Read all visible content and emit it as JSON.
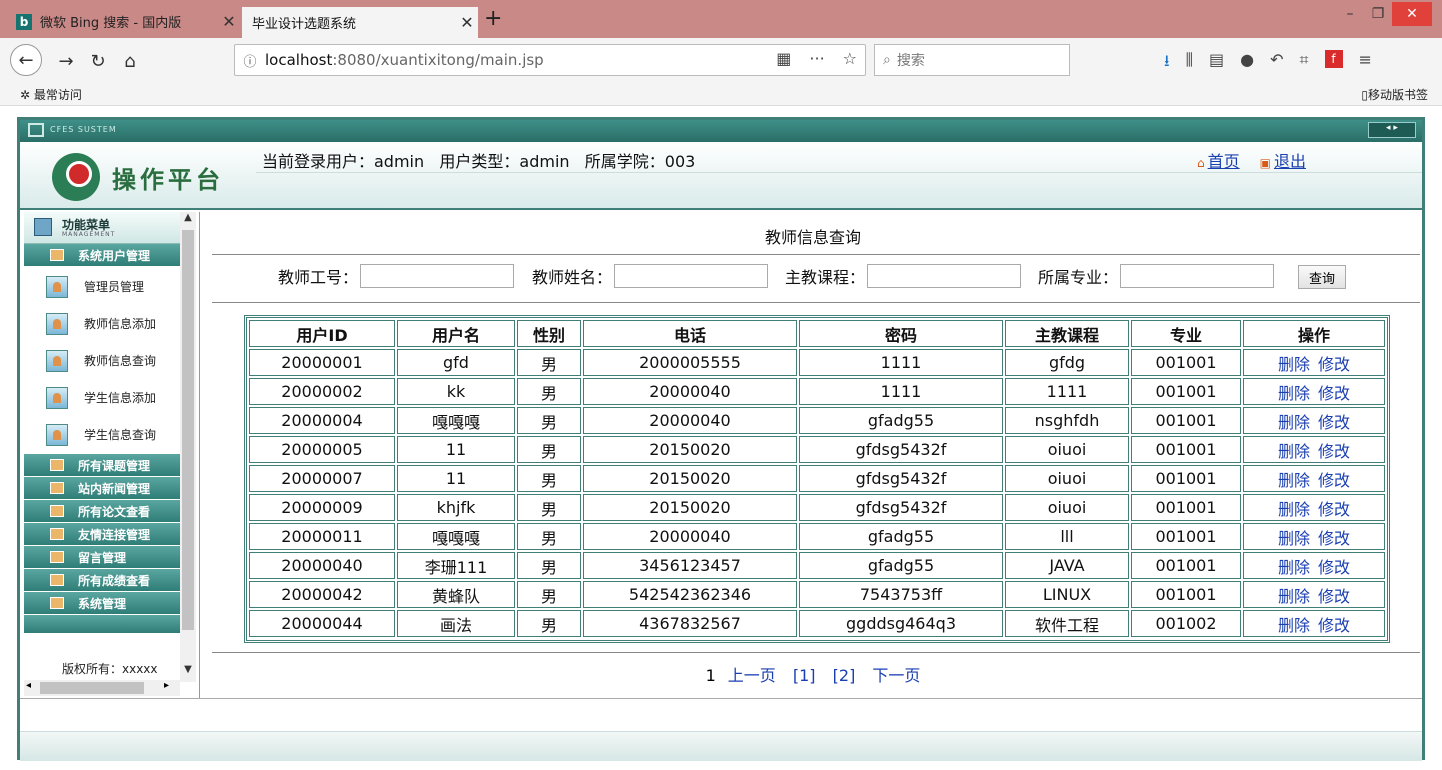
{
  "browser": {
    "tabs": [
      {
        "label": "微软 Bing 搜索 - 国内版",
        "favicon": "b"
      },
      {
        "label": "毕业设计选题系统"
      }
    ],
    "new_tab": "+",
    "url_host": "localhost",
    "url_rest": ":8080/xuantixitong/main.jsp",
    "search_placeholder": "搜索",
    "bookmarks_left": "最常访问",
    "bookmarks_right": "移动版书签"
  },
  "app": {
    "system_label": "CFES SUSTEM",
    "logo_text": "操作平台",
    "header_info": "当前登录用户：admin   用户类型：admin   所属学院：003",
    "links": {
      "home": "首页",
      "logout": "退出"
    }
  },
  "sidebar": {
    "title": "功能菜单",
    "subtitle": "MANAGEMENT",
    "groups": [
      "系统用户管理",
      "所有课题管理",
      "站内新闻管理",
      "所有论文查看",
      "友情连接管理",
      "留言管理",
      "所有成绩查看",
      "系统管理"
    ],
    "items": [
      "管理员管理",
      "教师信息添加",
      "教师信息查询",
      "学生信息添加",
      "学生信息查询"
    ],
    "copyright": "版权所有：xxxxx"
  },
  "main": {
    "title": "教师信息查询",
    "search": {
      "teacher_id_label": "教师工号：",
      "teacher_name_label": "教师姓名：",
      "course_label": "主教课程：",
      "major_label": "所属专业：",
      "button": "查询"
    },
    "table": {
      "headers": [
        "用户ID",
        "用户名",
        "性别",
        "电话",
        "密码",
        "主教课程",
        "专业",
        "操作"
      ],
      "rows": [
        [
          "20000001",
          "gfd",
          "男",
          "2000005555",
          "1111",
          "gfdg",
          "001001"
        ],
        [
          "20000002",
          "kk",
          "男",
          "20000040",
          "1111",
          "1111",
          "001001"
        ],
        [
          "20000004",
          "嘎嘎嘎",
          "男",
          "20000040",
          "gfadg55",
          "nsghfdh",
          "001001"
        ],
        [
          "20000005",
          "11",
          "男",
          "20150020",
          "gfdsg5432f",
          "oiuoi",
          "001001"
        ],
        [
          "20000007",
          "11",
          "男",
          "20150020",
          "gfdsg5432f",
          "oiuoi",
          "001001"
        ],
        [
          "20000009",
          "khjfk",
          "男",
          "20150020",
          "gfdsg5432f",
          "oiuoi",
          "001001"
        ],
        [
          "20000011",
          "嘎嘎嘎",
          "男",
          "20000040",
          "gfadg55",
          "lll",
          "001001"
        ],
        [
          "20000040",
          "李珊111",
          "男",
          "3456123457",
          "gfadg55",
          "JAVA",
          "001001"
        ],
        [
          "20000042",
          "黄蜂队",
          "男",
          "542542362346",
          "7543753ff",
          "LINUX",
          "001001"
        ],
        [
          "20000044",
          "画法",
          "男",
          "4367832567",
          "ggddsg464q3",
          "软件工程",
          "001002"
        ]
      ],
      "action_delete": "删除",
      "action_edit": "修改"
    },
    "pager": {
      "current": "1",
      "prev": "上一页",
      "pages": [
        "[1]",
        "[2]"
      ],
      "next": "下一页"
    }
  }
}
